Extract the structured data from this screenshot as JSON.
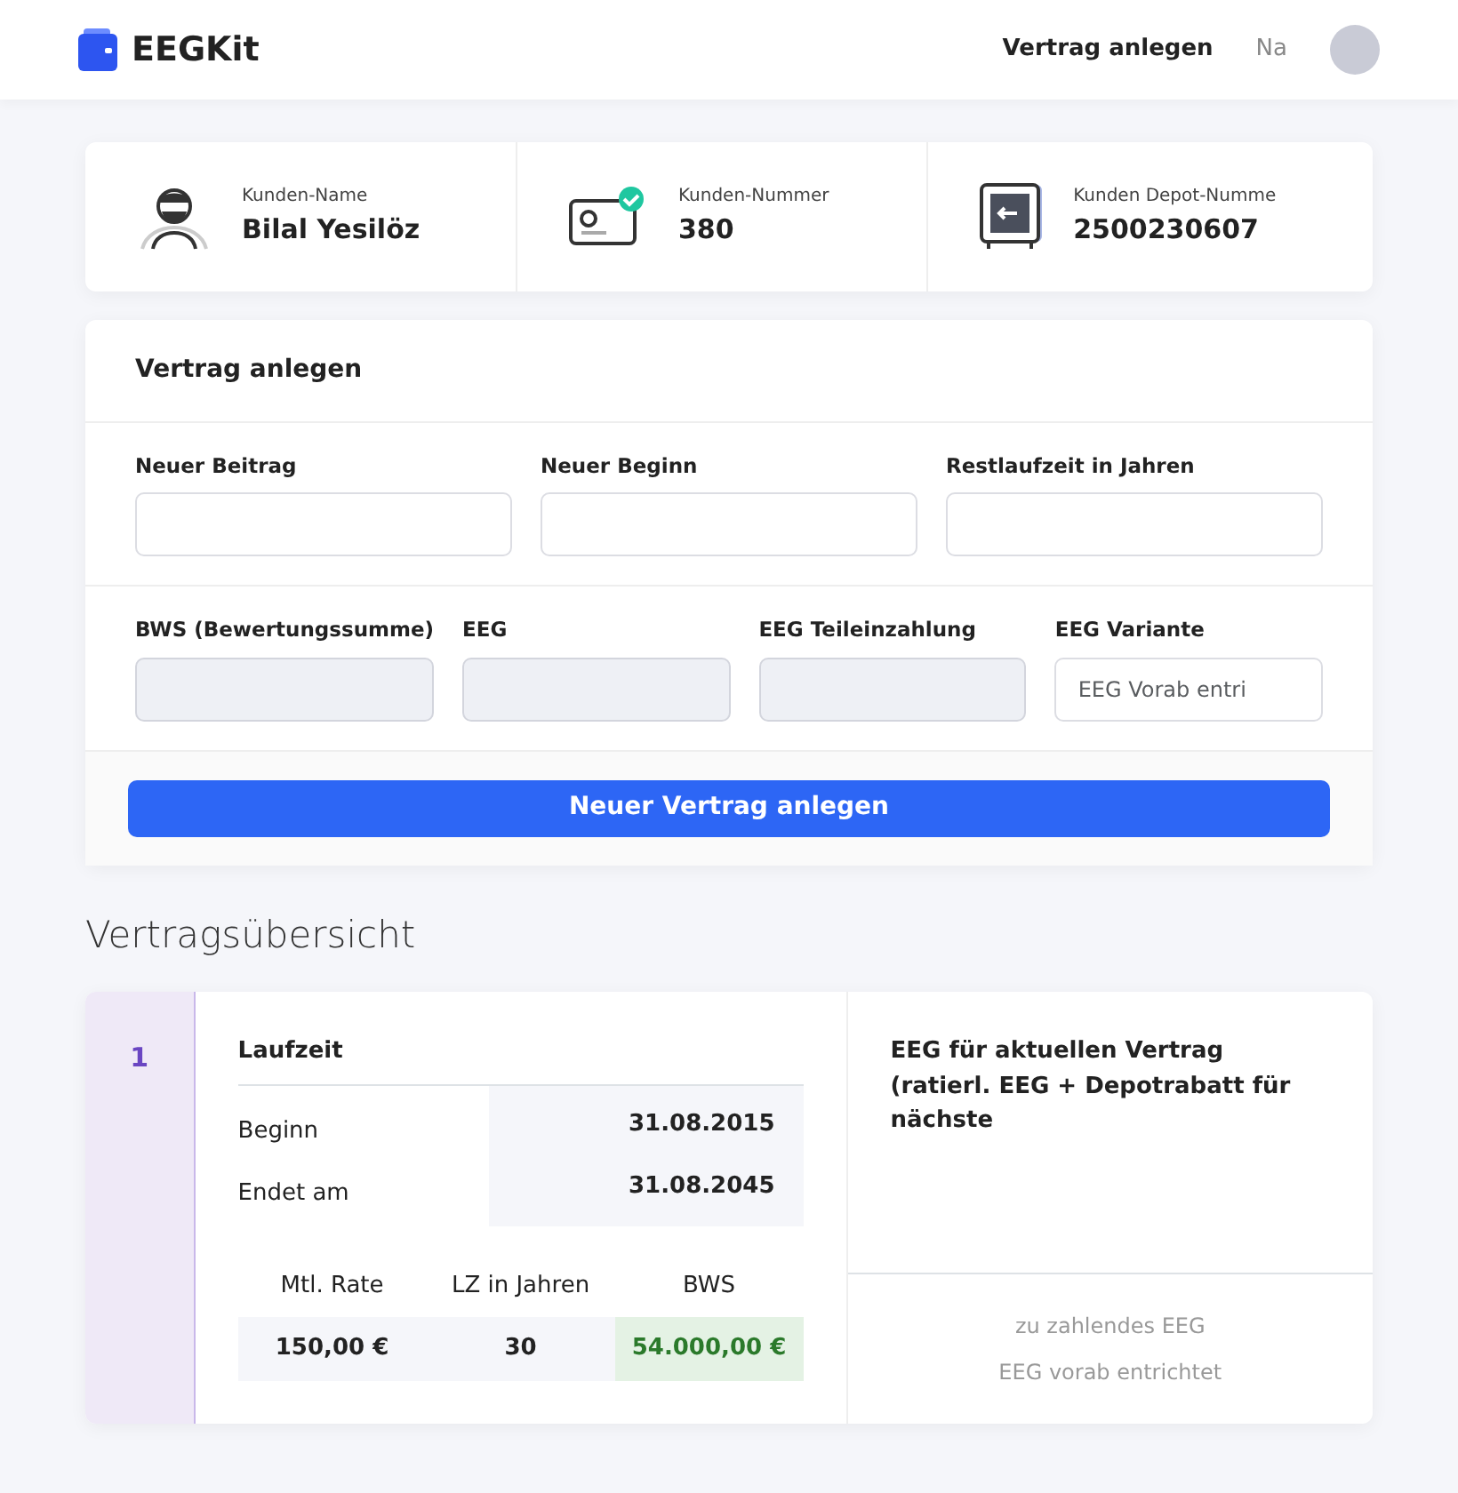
{
  "navbar": {
    "brand": "EEGKit",
    "links": [
      {
        "label": "Vertrag anlegen",
        "selected": true
      },
      {
        "label": "Na",
        "selected": false
      }
    ]
  },
  "customer": [
    {
      "kind": "person",
      "label": "Kunden-Name",
      "value": "Bilal Yesilöz"
    },
    {
      "kind": "card",
      "label": "Kunden-Nummer",
      "value": "380"
    },
    {
      "kind": "safe",
      "label": "Kunden Depot-Numme",
      "value": "2500230607"
    }
  ],
  "form": {
    "title": "Vertrag anlegen",
    "sections": [
      {
        "fields": [
          {
            "label": "Neuer Beitrag",
            "disabled": false
          },
          {
            "label": "Neuer Beginn",
            "disabled": false
          },
          {
            "label": "Restlaufzeit in Jahren",
            "disabled": false
          }
        ]
      },
      {
        "fields": [
          {
            "label": "BWS (Bewertungssumme)",
            "disabled": true
          },
          {
            "label": "EEG",
            "disabled": true
          },
          {
            "label": "EEG Teileinzahlung",
            "disabled": true
          },
          {
            "label": "EEG Variante",
            "disabled": false,
            "placeholder": "EEG Vorab entri"
          }
        ]
      }
    ],
    "submit": "Neuer Vertrag anlegen"
  },
  "overview": {
    "title": "Vertragsübersicht",
    "contract": {
      "number": "1",
      "laufzeit_title": "Laufzeit",
      "dates": [
        {
          "label": "Beginn",
          "value": "31.08.2015"
        },
        {
          "label": "Endet am",
          "value": "31.08.2045"
        }
      ],
      "columns": [
        "Mtl. Rate",
        "LZ in Jahren",
        "BWS"
      ],
      "values": [
        {
          "text": "150,00 €",
          "highlight": false
        },
        {
          "text": "30",
          "highlight": false
        },
        {
          "text": "54.000,00 €",
          "highlight": true
        }
      ]
    },
    "eeg": {
      "title": "EEG für aktuellen Vertrag",
      "subtitle": "(ratierl. EEG + Depotrabatt für nächste",
      "lines": [
        "zu zahlendes EEG",
        "EEG vorab entrichtet"
      ]
    }
  }
}
